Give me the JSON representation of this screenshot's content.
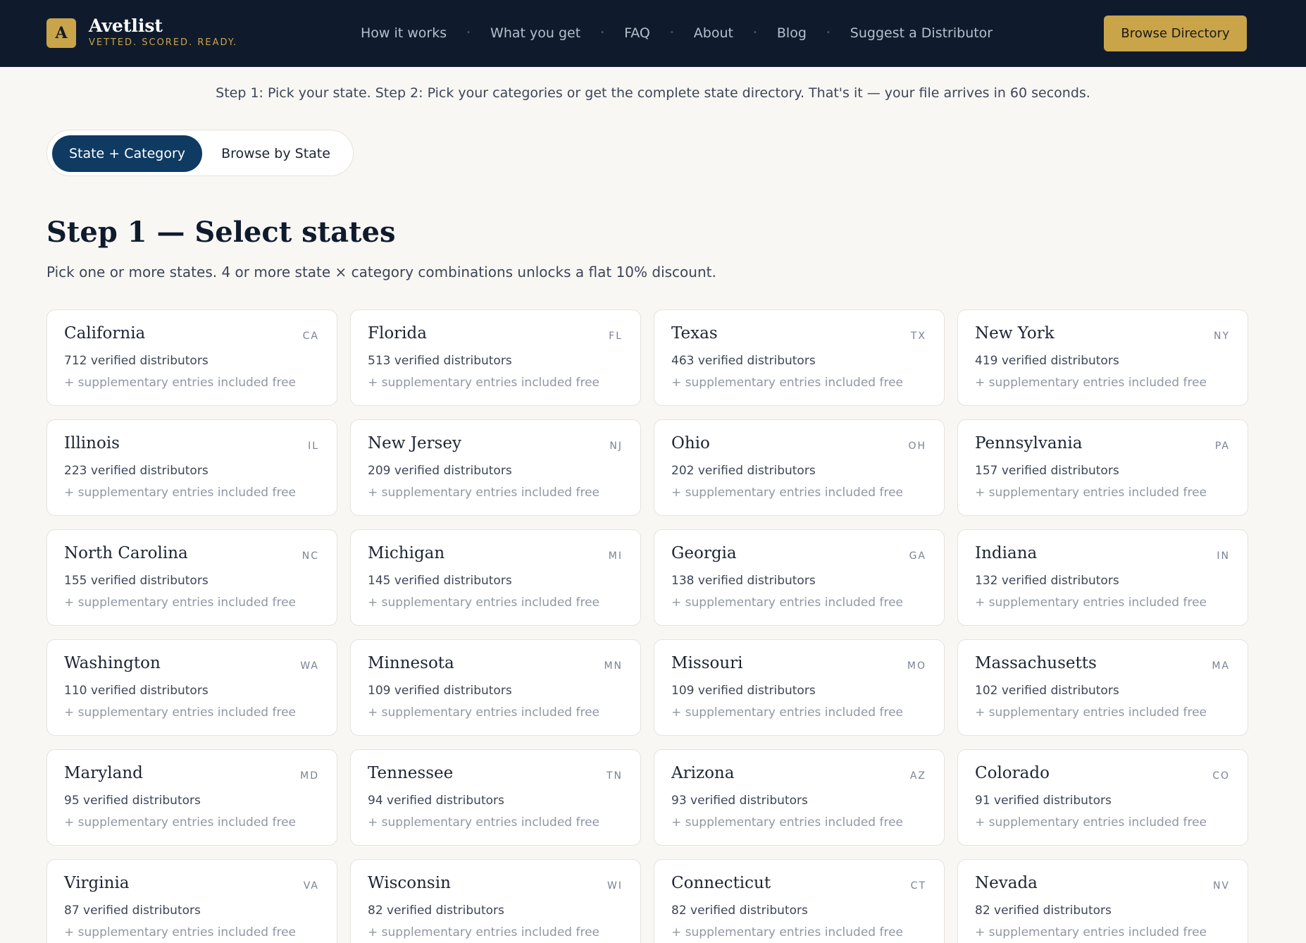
{
  "header": {
    "logo_letter": "A",
    "brand_name": "Avetlist",
    "brand_tagline": "VETTED. SCORED. READY.",
    "nav": [
      "How it works",
      "What you get",
      "FAQ",
      "About",
      "Blog",
      "Suggest a Distributor"
    ],
    "cta_label": "Browse Directory"
  },
  "intro": "Step 1: Pick your state. Step 2: Pick your categories or get the complete state directory. That's it — your file arrives in 60 seconds.",
  "mode_toggle": {
    "active_label": "State + Category",
    "inactive_label": "Browse by State"
  },
  "step1": {
    "title": "Step 1 — Select states",
    "subtitle": "Pick one or more states. 4 or more state × category combinations unlocks a flat 10% discount."
  },
  "states": [
    {
      "name": "California",
      "abbr": "CA",
      "count": "712 verified distributors",
      "extra": "+ supplementary entries included free"
    },
    {
      "name": "Florida",
      "abbr": "FL",
      "count": "513 verified distributors",
      "extra": "+ supplementary entries included free"
    },
    {
      "name": "Texas",
      "abbr": "TX",
      "count": "463 verified distributors",
      "extra": "+ supplementary entries included free"
    },
    {
      "name": "New York",
      "abbr": "NY",
      "count": "419 verified distributors",
      "extra": "+ supplementary entries included free"
    },
    {
      "name": "Illinois",
      "abbr": "IL",
      "count": "223 verified distributors",
      "extra": "+ supplementary entries included free"
    },
    {
      "name": "New Jersey",
      "abbr": "NJ",
      "count": "209 verified distributors",
      "extra": "+ supplementary entries included free"
    },
    {
      "name": "Ohio",
      "abbr": "OH",
      "count": "202 verified distributors",
      "extra": "+ supplementary entries included free"
    },
    {
      "name": "Pennsylvania",
      "abbr": "PA",
      "count": "157 verified distributors",
      "extra": "+ supplementary entries included free"
    },
    {
      "name": "North Carolina",
      "abbr": "NC",
      "count": "155 verified distributors",
      "extra": "+ supplementary entries included free"
    },
    {
      "name": "Michigan",
      "abbr": "MI",
      "count": "145 verified distributors",
      "extra": "+ supplementary entries included free"
    },
    {
      "name": "Georgia",
      "abbr": "GA",
      "count": "138 verified distributors",
      "extra": "+ supplementary entries included free"
    },
    {
      "name": "Indiana",
      "abbr": "IN",
      "count": "132 verified distributors",
      "extra": "+ supplementary entries included free"
    },
    {
      "name": "Washington",
      "abbr": "WA",
      "count": "110 verified distributors",
      "extra": "+ supplementary entries included free"
    },
    {
      "name": "Minnesota",
      "abbr": "MN",
      "count": "109 verified distributors",
      "extra": "+ supplementary entries included free"
    },
    {
      "name": "Missouri",
      "abbr": "MO",
      "count": "109 verified distributors",
      "extra": "+ supplementary entries included free"
    },
    {
      "name": "Massachusetts",
      "abbr": "MA",
      "count": "102 verified distributors",
      "extra": "+ supplementary entries included free"
    },
    {
      "name": "Maryland",
      "abbr": "MD",
      "count": "95 verified distributors",
      "extra": "+ supplementary entries included free"
    },
    {
      "name": "Tennessee",
      "abbr": "TN",
      "count": "94 verified distributors",
      "extra": "+ supplementary entries included free"
    },
    {
      "name": "Arizona",
      "abbr": "AZ",
      "count": "93 verified distributors",
      "extra": "+ supplementary entries included free"
    },
    {
      "name": "Colorado",
      "abbr": "CO",
      "count": "91 verified distributors",
      "extra": "+ supplementary entries included free"
    },
    {
      "name": "Virginia",
      "abbr": "VA",
      "count": "87 verified distributors",
      "extra": "+ supplementary entries included free"
    },
    {
      "name": "Wisconsin",
      "abbr": "WI",
      "count": "82 verified distributors",
      "extra": "+ supplementary entries included free"
    },
    {
      "name": "Connecticut",
      "abbr": "CT",
      "count": "82 verified distributors",
      "extra": "+ supplementary entries included free"
    },
    {
      "name": "Nevada",
      "abbr": "NV",
      "count": "82 verified distributors",
      "extra": "+ supplementary entries included free"
    }
  ],
  "colors": {
    "header_bg": "#0f1b2d",
    "accent_gold": "#c9a449",
    "toggle_active": "#0f3a62",
    "page_bg": "#f8f7f4"
  }
}
